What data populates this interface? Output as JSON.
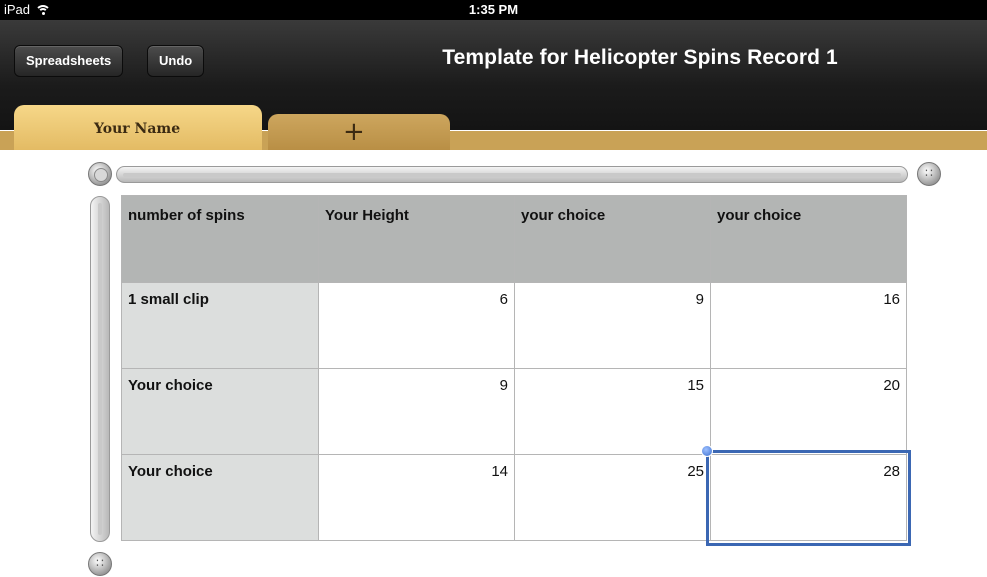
{
  "status_bar": {
    "device": "iPad",
    "time": "1:35 PM"
  },
  "toolbar": {
    "spreadsheets_label": "Spreadsheets",
    "undo_label": "Undo",
    "title": "Template for Helicopter Spins Record 1"
  },
  "tabs": [
    {
      "label": "Your Name",
      "active": true
    }
  ],
  "sheet": {
    "headers": [
      "number of spins",
      "Your Height",
      "your choice",
      "your choice"
    ],
    "rows": [
      {
        "label": "1 small clip",
        "values": [
          "6",
          "9",
          "16"
        ]
      },
      {
        "label": "Your choice",
        "values": [
          "9",
          "15",
          "20"
        ]
      },
      {
        "label": "Your choice",
        "values": [
          "14",
          "25",
          "28"
        ]
      }
    ],
    "selected_cell": {
      "row": 3,
      "col": 4
    }
  },
  "colors": {
    "accent": "#3b67b3",
    "tab": "#f2cf7d",
    "header_fill": "#b3b5b4",
    "rowhead_fill": "#dcdedd"
  }
}
